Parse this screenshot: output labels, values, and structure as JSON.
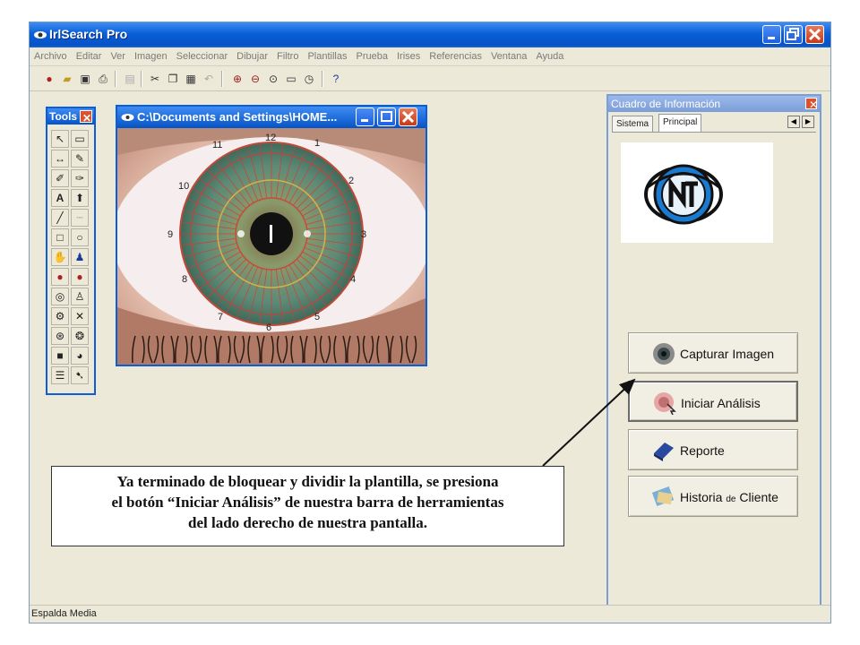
{
  "window": {
    "title": "IrlSearch Pro"
  },
  "menubar": {
    "items": [
      "Archivo",
      "Editar",
      "Ver",
      "Imagen",
      "Seleccionar",
      "Dibujar",
      "Filtro",
      "Plantillas",
      "Prueba",
      "Irises",
      "Referencias",
      "Ventana",
      "Ayuda"
    ]
  },
  "tools": {
    "title": "Tools"
  },
  "image_window": {
    "title": "C:\\Documents and Settings\\HOME...",
    "clock_numbers": [
      "12",
      "1",
      "2",
      "3",
      "4",
      "5",
      "6",
      "7",
      "8",
      "9",
      "10",
      "11"
    ]
  },
  "info_panel": {
    "title": "Cuadro de Información",
    "tabs": [
      "Sistema",
      "Principal"
    ],
    "active_tab": "Principal",
    "buttons": {
      "capture": "Capturar Imagen",
      "analyze": "Iniciar Análisis",
      "report": "Reporte",
      "history_pre": "Historia",
      "history_mid": "de",
      "history_post": "Cliente"
    }
  },
  "statusbar": {
    "text": "Espalda Media"
  },
  "callout": {
    "line1": "Ya terminado de bloquear y dividir la plantilla, se presiona",
    "line2": "el botón “Iniciar Análisis” de nuestra barra de herramientas",
    "line3": "del lado derecho de nuestra pantalla."
  },
  "colors": {
    "titlebar": "#0a5fd8",
    "panel_border": "#7b9ed6",
    "iris": "#5a8a72",
    "template_lines": "#d23a3a"
  }
}
